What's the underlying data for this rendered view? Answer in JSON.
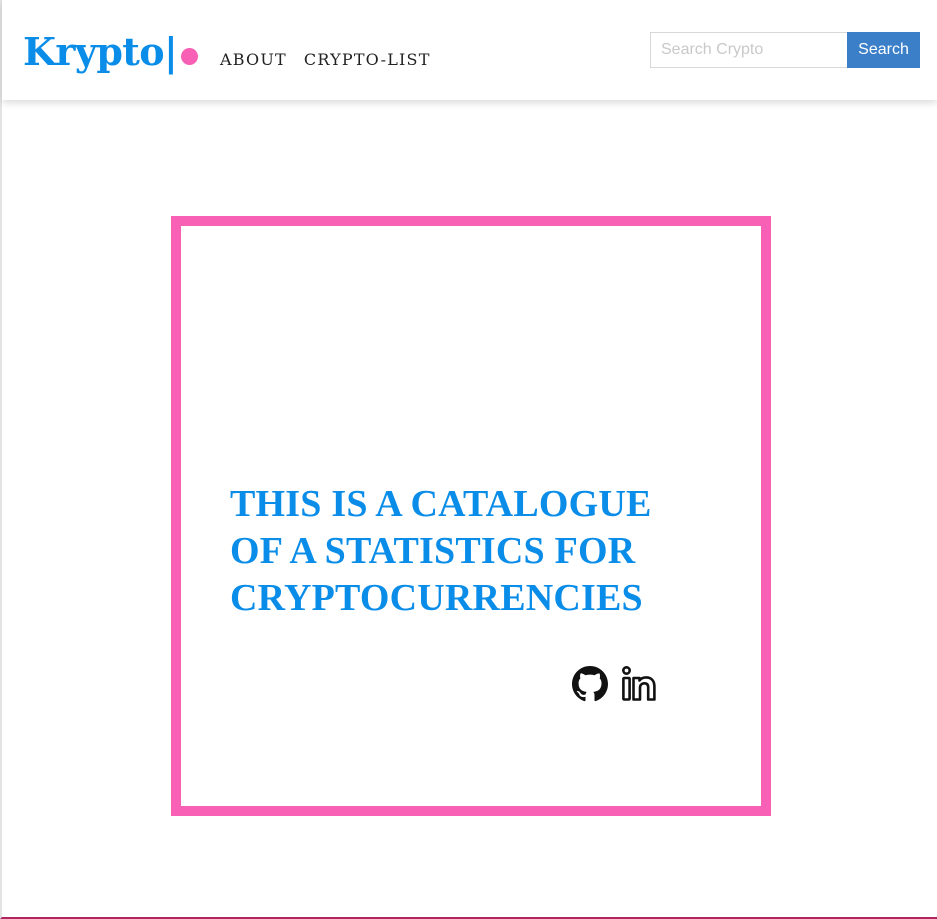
{
  "navbar": {
    "brand": "Krypto|",
    "links": [
      {
        "label": "ABOUT"
      },
      {
        "label": "CRYPTO-LIST"
      }
    ],
    "search": {
      "placeholder": "Search Crypto",
      "value": "",
      "button_label": "Search"
    }
  },
  "hero": {
    "title": "THIS IS A CATALOGUE OF A STATISTICS FOR CRYPTOCURRENCIES",
    "social": [
      {
        "icon": "github-icon"
      },
      {
        "icon": "linkedin-icon"
      }
    ]
  },
  "colors": {
    "brand_blue": "#0a8de8",
    "accent_pink": "#f760b5",
    "button_blue": "#3b7fc8"
  }
}
